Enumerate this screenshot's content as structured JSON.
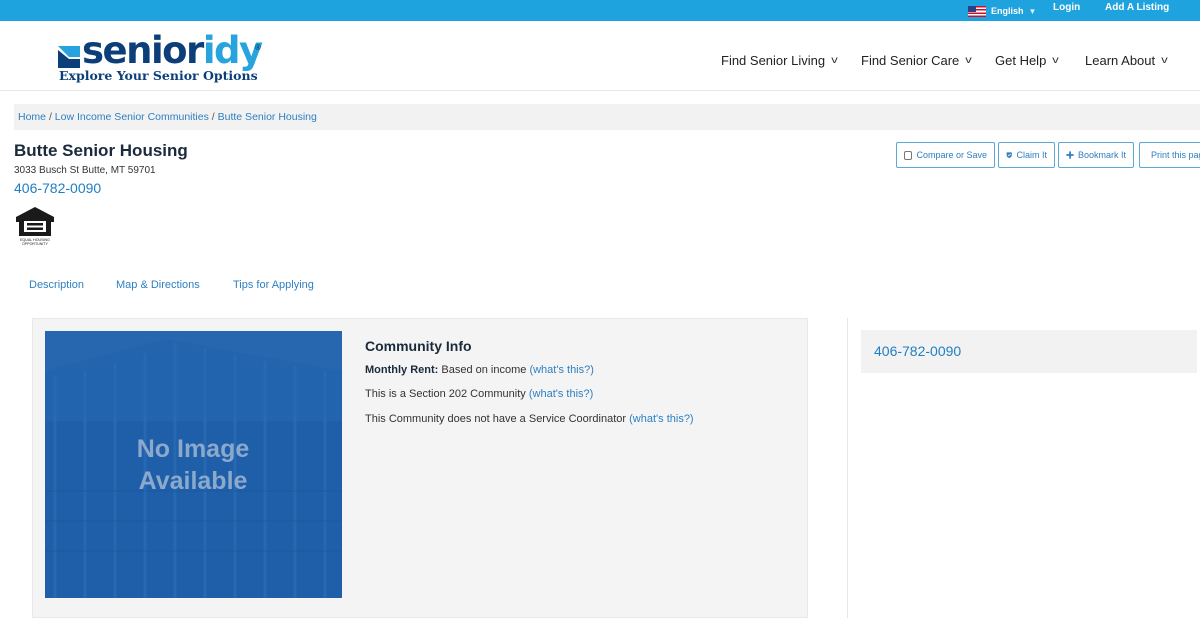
{
  "topbar": {
    "language": "English",
    "login": "Login",
    "add_listing": "Add A Listing"
  },
  "logo": {
    "wordmark_part1": "senior",
    "wordmark_part2": "idy",
    "registered": "®",
    "tagline": "Explore Your Senior Options"
  },
  "nav": [
    {
      "label": "Find Senior Living"
    },
    {
      "label": "Find Senior Care"
    },
    {
      "label": "Get Help"
    },
    {
      "label": "Learn About"
    }
  ],
  "breadcrumb": {
    "items": [
      "Home",
      "Low Income Senior Communities",
      "Butte Senior Housing"
    ],
    "separator": "/"
  },
  "listing": {
    "title": "Butte Senior Housing",
    "address": "3033 Busch St Butte, MT 59701",
    "phone": "406-782-0090",
    "equal_housing_text_1": "EQUAL HOUSING",
    "equal_housing_text_2": "OPPORTUNITY"
  },
  "actions": {
    "compare": "Compare or Save",
    "claim": "Claim It",
    "bookmark": "Bookmark It",
    "print": "Print this page"
  },
  "tabs": [
    {
      "label": "Description"
    },
    {
      "label": "Map & Directions"
    },
    {
      "label": "Tips for Applying"
    }
  ],
  "image": {
    "line1": "No Image",
    "line2": "Available"
  },
  "community_info": {
    "heading": "Community Info",
    "rent_label": "Monthly Rent:",
    "rent_value": "Based on income",
    "section_text": "This is a Section 202 Community",
    "coordinator_text": "This Community does not have a Service Coordinator",
    "whats_this": "(what's this?)"
  },
  "sidebar": {
    "phone": "406-782-0090"
  },
  "colors": {
    "topbar": "#1ea3de",
    "link": "#2e7fc1",
    "brand_dark": "#0c3f7a",
    "brand_light": "#27a3dd",
    "image_blue": "#1f5fa8"
  }
}
